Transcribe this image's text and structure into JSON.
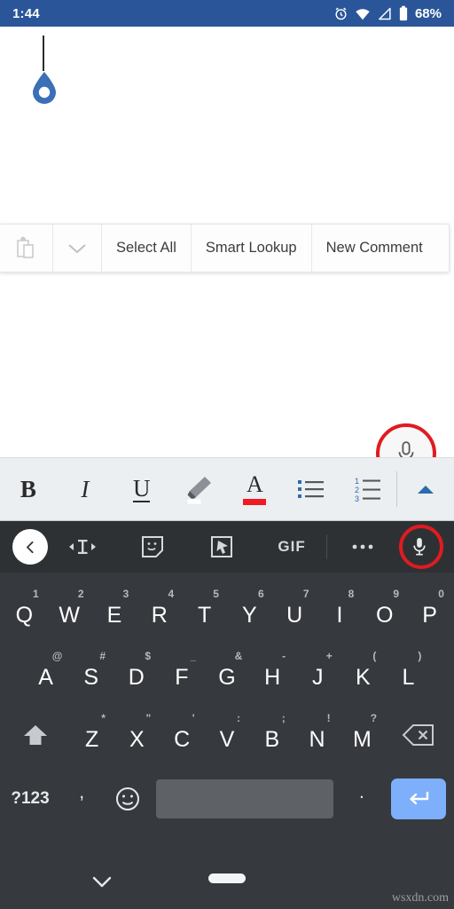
{
  "status_bar": {
    "time": "1:44",
    "battery_percent": "68%",
    "icons": [
      "alarm-icon",
      "wifi-icon",
      "signal-icon",
      "battery-icon"
    ],
    "background_color": "#2a5699"
  },
  "document": {
    "caret_visible": true,
    "selection_handle": "text-selection-handle",
    "handle_color": "#3b6fb6",
    "body_text": ""
  },
  "context_menu": {
    "items": [
      {
        "type": "icon",
        "name": "paste-icon",
        "label": ""
      },
      {
        "type": "icon",
        "name": "chevron-down-icon",
        "label": ""
      },
      {
        "type": "text",
        "name": "select-all",
        "label": "Select All"
      },
      {
        "type": "text",
        "name": "smart-lookup",
        "label": "Smart Lookup"
      },
      {
        "type": "text",
        "name": "new-comment",
        "label": "New Comment"
      }
    ]
  },
  "dictate_fab": {
    "icon": "microphone-icon",
    "annotated": true,
    "annotation_color": "#e01b20"
  },
  "format_toolbar": {
    "items": [
      {
        "name": "bold-button",
        "label": "B"
      },
      {
        "name": "italic-button",
        "label": "I"
      },
      {
        "name": "underline-button",
        "label": "U"
      },
      {
        "name": "highlight-button",
        "label": ""
      },
      {
        "name": "font-color-button",
        "label": "A"
      },
      {
        "name": "bulleted-list-button",
        "label": ""
      },
      {
        "name": "numbered-list-button",
        "label": ""
      },
      {
        "name": "expand-toolbar-button",
        "label": ""
      }
    ],
    "font_color_swatch": "#ee1b24",
    "highlight_swatch": "#ffffff",
    "list_accent": "#2b6cb0",
    "background_color": "#eceff1",
    "numbered_list_digits": [
      "1",
      "2",
      "3"
    ]
  },
  "keyboard": {
    "background_color": "#36393d",
    "toolbar": {
      "background_color": "#2e3134",
      "items": [
        {
          "name": "back-button",
          "icon": "chevron-left-icon",
          "label": ""
        },
        {
          "name": "text-edit-button",
          "icon": "text-cursor-icon",
          "label": ""
        },
        {
          "name": "sticker-button",
          "icon": "sticker-icon",
          "label": ""
        },
        {
          "name": "translate-button",
          "icon": "select-pointer-icon",
          "label": ""
        },
        {
          "name": "gif-button",
          "icon": "gif-icon",
          "label": "GIF"
        },
        {
          "name": "more-options-button",
          "icon": "overflow-dots-icon",
          "label": ""
        },
        {
          "name": "voice-input-button",
          "icon": "microphone-icon",
          "label": ""
        }
      ],
      "mic_annotated": true,
      "annotation_color": "#e01b20"
    },
    "row1": [
      {
        "letter": "Q",
        "number": "1"
      },
      {
        "letter": "W",
        "number": "2"
      },
      {
        "letter": "E",
        "number": "3"
      },
      {
        "letter": "R",
        "number": "4"
      },
      {
        "letter": "T",
        "number": "5"
      },
      {
        "letter": "Y",
        "number": "6"
      },
      {
        "letter": "U",
        "number": "7"
      },
      {
        "letter": "I",
        "number": "8"
      },
      {
        "letter": "O",
        "number": "9"
      },
      {
        "letter": "P",
        "number": "0"
      }
    ],
    "row2": [
      {
        "letter": "A",
        "number": "@"
      },
      {
        "letter": "S",
        "number": "#"
      },
      {
        "letter": "D",
        "number": "$"
      },
      {
        "letter": "F",
        "number": "_"
      },
      {
        "letter": "G",
        "number": "&"
      },
      {
        "letter": "H",
        "number": "-"
      },
      {
        "letter": "J",
        "number": "+"
      },
      {
        "letter": "K",
        "number": "("
      },
      {
        "letter": "L",
        "number": ")"
      }
    ],
    "row3": [
      {
        "letter": "Z",
        "number": "*"
      },
      {
        "letter": "X",
        "number": "\""
      },
      {
        "letter": "C",
        "number": "'"
      },
      {
        "letter": "V",
        "number": ":"
      },
      {
        "letter": "B",
        "number": ";"
      },
      {
        "letter": "N",
        "number": "!"
      },
      {
        "letter": "M",
        "number": "?"
      }
    ],
    "shift_key": {
      "name": "shift-key",
      "icon": "shift-arrow-icon"
    },
    "backspace_key": {
      "name": "backspace-key",
      "icon": "backspace-icon"
    },
    "row4": {
      "symbols_key": "?123",
      "comma_key": ",",
      "emoji_key": "",
      "space_key": "",
      "period_key": ".",
      "enter_key": "",
      "enter_color": "#7eaffb",
      "space_color": "#5e6165"
    }
  },
  "nav_bar": {
    "hide_keyboard_icon": "chevron-down-icon",
    "home_indicator": "home-pill",
    "watermark": "wsxdn.com"
  }
}
